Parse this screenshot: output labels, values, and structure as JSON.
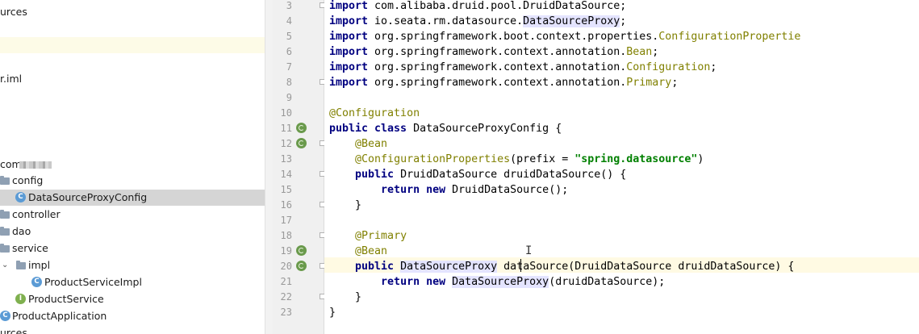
{
  "project_tree": {
    "rows": [
      {
        "label": "urces"
      },
      {
        "label": ""
      },
      {
        "label": "r.iml"
      },
      {
        "label": "com"
      },
      {
        "label": "config"
      },
      {
        "label": "DataSourceProxyConfig",
        "badge": "C"
      },
      {
        "label": "controller"
      },
      {
        "label": "dao"
      },
      {
        "label": "service"
      },
      {
        "label": "impl"
      },
      {
        "label": "ProductServiceImpl",
        "badge": "C"
      },
      {
        "label": "ProductService",
        "badge": "I"
      },
      {
        "label": "ProductApplication",
        "badge": "C"
      },
      {
        "label": "urces"
      }
    ]
  },
  "editor": {
    "line_numbers": [
      "3",
      "4",
      "5",
      "6",
      "7",
      "8",
      "9",
      "10",
      "11",
      "12",
      "13",
      "14",
      "15",
      "16",
      "17",
      "18",
      "19",
      "20",
      "21",
      "22",
      "23"
    ],
    "lines": [
      [
        "import ",
        "com.alibaba.druid.pool.DruidDataSource;"
      ],
      [
        "import ",
        "io.seata.rm.datasource.",
        "DataSourceProxy",
        ";"
      ],
      [
        "import ",
        "org.springframework.boot.context.properties.",
        "ConfigurationPropertie"
      ],
      [
        "import ",
        "org.springframework.context.annotation.",
        "Bean",
        ";"
      ],
      [
        "import ",
        "org.springframework.context.annotation.",
        "Configuration",
        ";"
      ],
      [
        "import ",
        "org.springframework.context.annotation.",
        "Primary",
        ";"
      ],
      [],
      [
        "@Configuration"
      ],
      [
        "public class ",
        "DataSourceProxyConfig {"
      ],
      [
        "    ",
        "@Bean"
      ],
      [
        "    ",
        "@ConfigurationProperties",
        "(prefix = ",
        "\"spring.datasource\"",
        ")"
      ],
      [
        "    ",
        "public ",
        "DruidDataSource druidDataSource() {"
      ],
      [
        "        ",
        "return new ",
        "DruidDataSource();"
      ],
      [
        "    }"
      ],
      [],
      [
        "    ",
        "@Primary"
      ],
      [
        "    ",
        "@Bean"
      ],
      [
        "    ",
        "public ",
        "DataSourceProxy",
        " dataSource(DruidDataSource druidDataSource) {"
      ],
      [
        "        ",
        "return new ",
        "DataSourceProxy",
        "(druidDataSource);"
      ],
      [
        "    }"
      ],
      [
        "}"
      ]
    ]
  }
}
